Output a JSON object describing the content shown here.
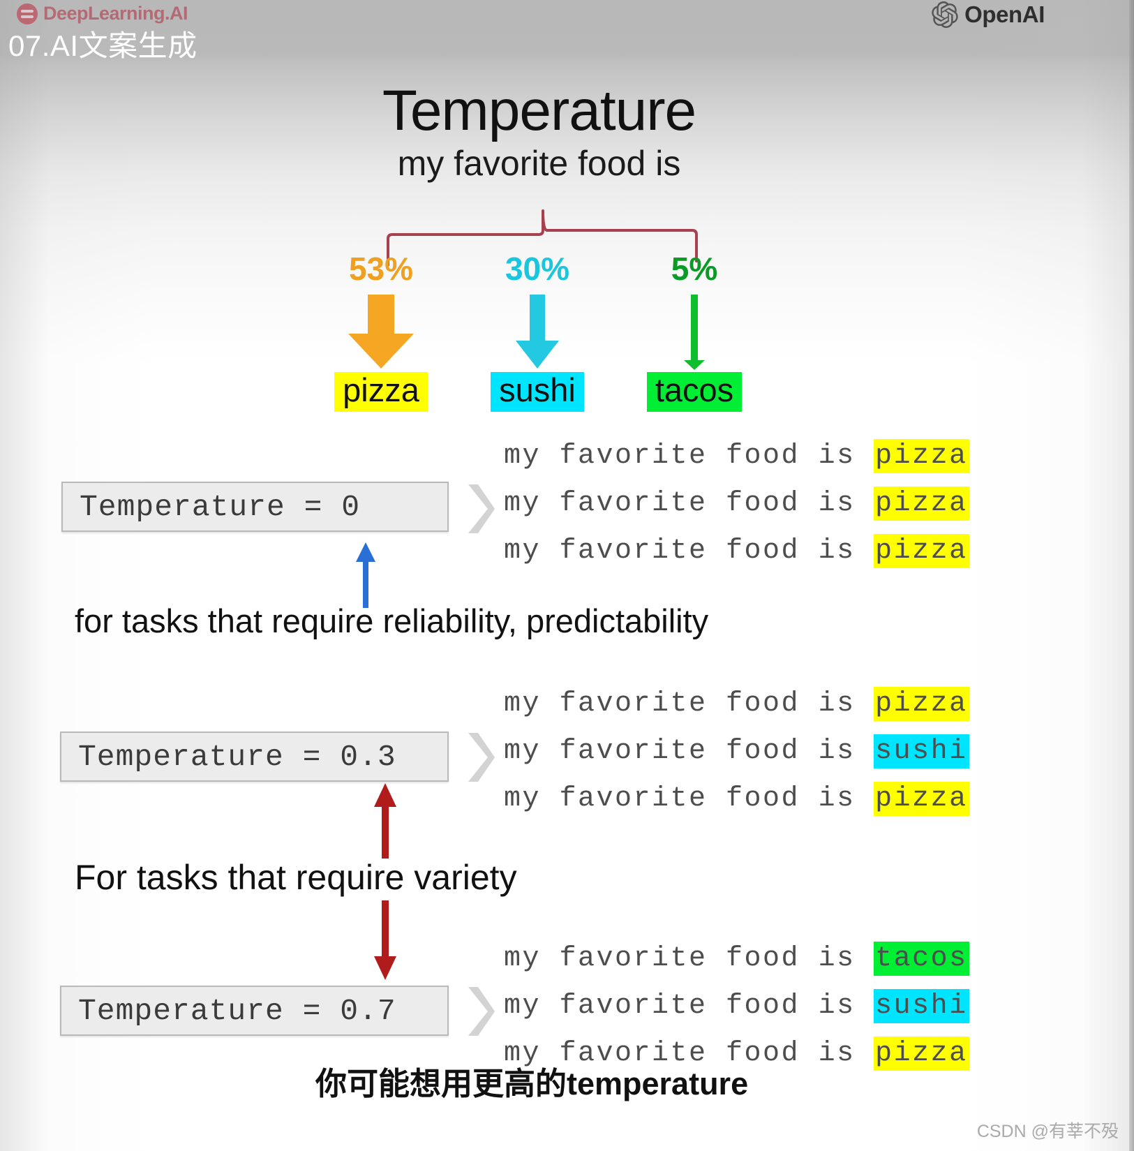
{
  "branding": {
    "deeplearning_label": "DeepLearning.AI",
    "openai_label": "OpenAI",
    "deeplearning_color": "#b33c4c"
  },
  "overlay": {
    "course_title_cn": "07.AI文案生成",
    "bottom_note_cn": "你可能想用更高的temperature",
    "watermark": "CSDN @有莘不殁"
  },
  "slide": {
    "title": "Temperature",
    "prompt": "my favorite food is"
  },
  "distribution": {
    "bracket_color": "#a8414f",
    "tokens": [
      {
        "percent": "53%",
        "label": "pizza",
        "pct_color": "#f0a020",
        "arrow_color": "#f5a623",
        "chip_color": "#ffff00",
        "arrow_type": "thick-down-arrow"
      },
      {
        "percent": "30%",
        "label": "sushi",
        "pct_color": "#19c6dd",
        "arrow_color": "#22c9e0",
        "chip_color": "#00e5ff",
        "arrow_type": "medium-down-arrow"
      },
      {
        "percent": "5%",
        "label": "tacos",
        "pct_color": "#0a9a26",
        "arrow_color": "#0fbe2c",
        "chip_color": "#00ee33",
        "arrow_type": "thin-down-arrow"
      }
    ]
  },
  "examples": [
    {
      "temperature_label": "Temperature = 0",
      "chevron_icon": "chevron-right-icon",
      "outputs": [
        {
          "prefix": "my favorite food is ",
          "token": "pizza",
          "highlight": "#ffff00"
        },
        {
          "prefix": "my favorite food is ",
          "token": "pizza",
          "highlight": "#ffff00"
        },
        {
          "prefix": "my favorite food is ",
          "token": "pizza",
          "highlight": "#ffff00"
        }
      ]
    },
    {
      "temperature_label": "Temperature = 0.3",
      "chevron_icon": "chevron-right-icon",
      "outputs": [
        {
          "prefix": "my favorite food is ",
          "token": "pizza",
          "highlight": "#ffff00"
        },
        {
          "prefix": "my favorite food is ",
          "token": "sushi",
          "highlight": "#00e5ff"
        },
        {
          "prefix": "my favorite food is ",
          "token": "pizza",
          "highlight": "#ffff00"
        }
      ]
    },
    {
      "temperature_label": "Temperature = 0.7",
      "chevron_icon": "chevron-right-icon",
      "outputs": [
        {
          "prefix": "my favorite food is ",
          "token": "tacos",
          "highlight": "#00ee33"
        },
        {
          "prefix": "my favorite food is ",
          "token": "sushi",
          "highlight": "#00e5ff"
        },
        {
          "prefix": "my favorite food is ",
          "token": "pizza",
          "highlight": "#ffff00"
        }
      ]
    }
  ],
  "captions": {
    "reliability": "for tasks that require reliability, predictability",
    "variety": "For tasks that require variety"
  },
  "annotations": {
    "up_arrow_color": "#2a6fd6",
    "variety_arrow_color": "#b01c1c"
  }
}
